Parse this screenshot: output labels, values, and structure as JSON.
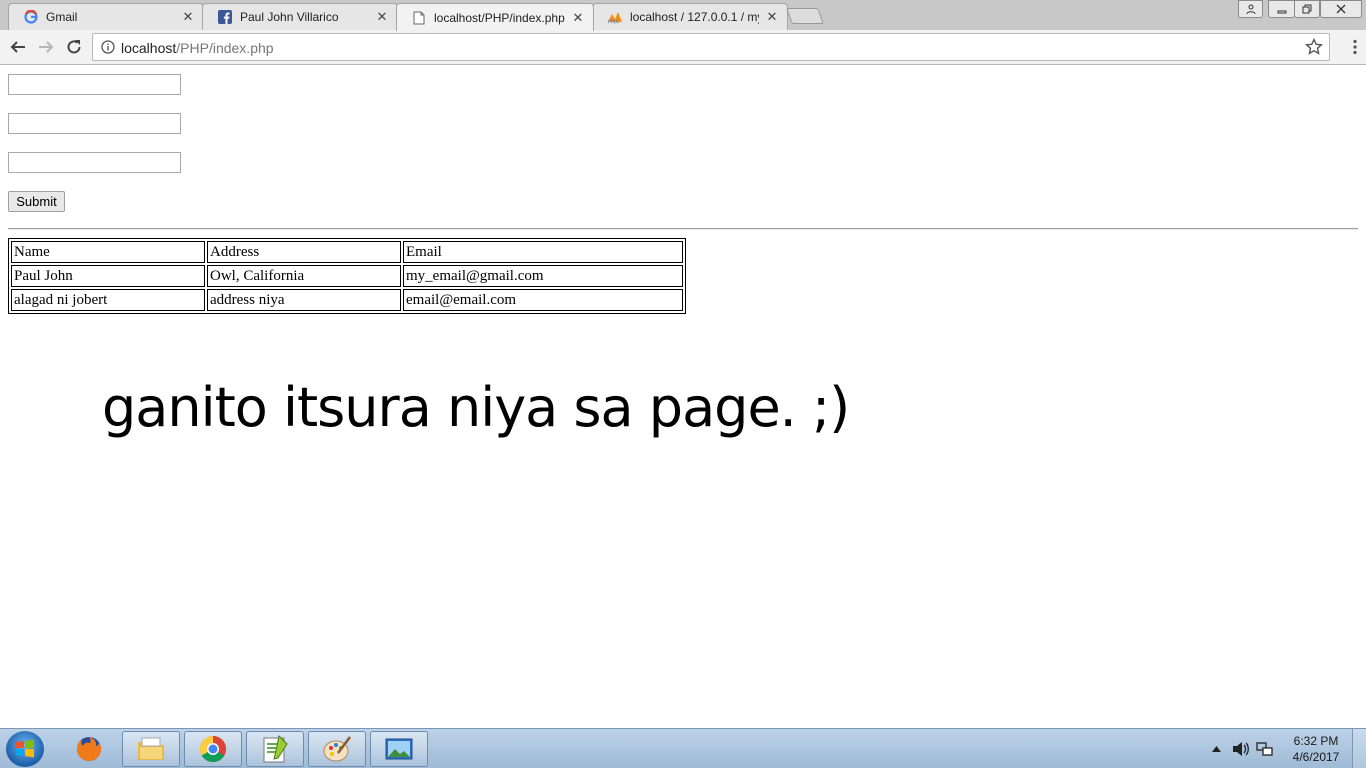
{
  "browser": {
    "tabs": [
      {
        "title": "Gmail",
        "icon": "google-icon",
        "active": false
      },
      {
        "title": "Paul John Villarico",
        "icon": "facebook-icon",
        "active": false
      },
      {
        "title": "localhost/PHP/index.php",
        "icon": "page-icon",
        "active": true
      },
      {
        "title": "localhost / 127.0.0.1 / my",
        "icon": "phpmyadmin-icon",
        "active": false
      }
    ],
    "close_glyph": "✕",
    "address": {
      "host": "localhost",
      "path": "/PHP/index.php"
    }
  },
  "form": {
    "inputs": [
      {
        "value": ""
      },
      {
        "value": ""
      },
      {
        "value": ""
      }
    ],
    "submit_label": "Submit"
  },
  "table": {
    "headers": [
      "Name",
      "Address",
      "Email"
    ],
    "rows": [
      [
        "Paul John",
        "Owl, California",
        "my_email@gmail.com"
      ],
      [
        "alagad ni jobert",
        "address niya",
        "email@email.com"
      ]
    ]
  },
  "message": "ganito itsura niya sa page. ;)",
  "taskbar": {
    "apps": [
      "firefox-icon",
      "file-explorer-icon",
      "chrome-icon",
      "notepad-plus-icon",
      "paint-icon",
      "photo-viewer-icon"
    ],
    "clock_time": "6:32 PM",
    "clock_date": "4/6/2017"
  },
  "colors": {
    "tabstrip": "#c8c8c8",
    "toolbar": "#f2f2f2",
    "taskbar": "#a9c2dc",
    "facebook": "#3b5998"
  }
}
